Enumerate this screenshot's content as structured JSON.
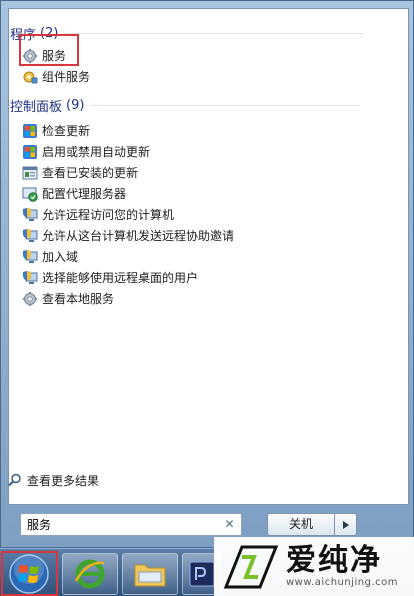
{
  "programs": {
    "title": "程序",
    "count": "(2)",
    "items": [
      {
        "label": "服务",
        "icon": "gear-icon"
      },
      {
        "label": "组件服务",
        "icon": "component-services-icon"
      }
    ]
  },
  "control_panel": {
    "title": "控制面板",
    "count": "(9)",
    "items": [
      {
        "label": "检查更新",
        "icon": "windows-update-icon"
      },
      {
        "label": "启用或禁用自动更新",
        "icon": "windows-update-icon"
      },
      {
        "label": "查看已安装的更新",
        "icon": "installed-updates-icon"
      },
      {
        "label": "配置代理服务器",
        "icon": "proxy-icon"
      },
      {
        "label": "允许远程访问您的计算机",
        "icon": "shield-computer-icon"
      },
      {
        "label": "允许从这台计算机发送远程协助邀请",
        "icon": "shield-computer-icon"
      },
      {
        "label": "加入域",
        "icon": "shield-computer-icon"
      },
      {
        "label": "选择能够使用远程桌面的用户",
        "icon": "shield-computer-icon"
      },
      {
        "label": "查看本地服务",
        "icon": "gear-icon"
      }
    ]
  },
  "see_more": "查看更多结果",
  "search": {
    "value": "服务"
  },
  "shutdown_label": "关机",
  "watermark": {
    "title": "爱纯净",
    "url": "www.aichunjing.com"
  },
  "colors": {
    "group_header": "#1e3287",
    "highlight": "#d7373c"
  }
}
